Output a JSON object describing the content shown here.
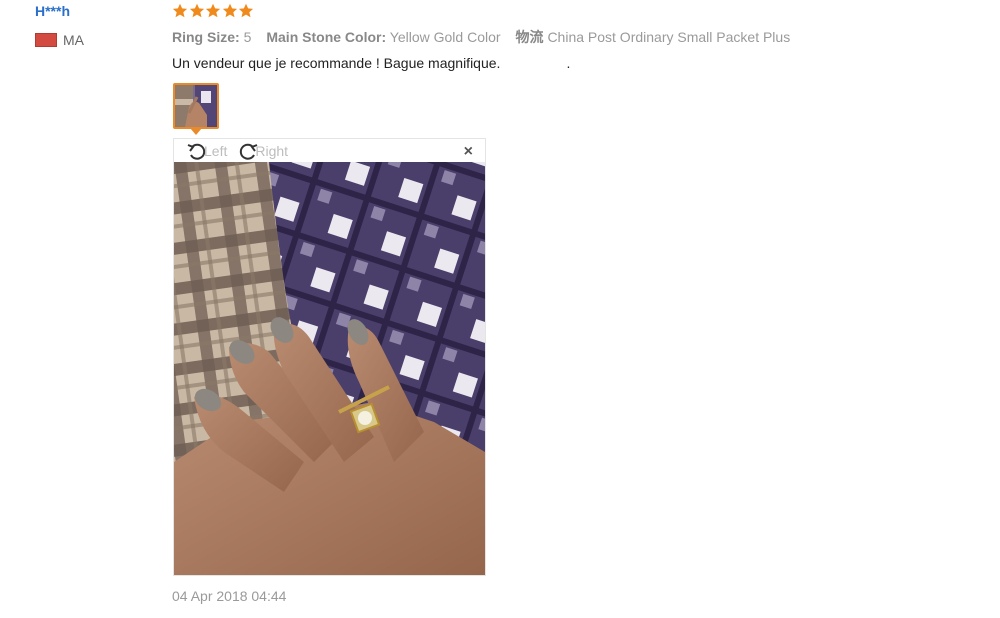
{
  "buyer": {
    "name": "H***h",
    "country_code": "MA"
  },
  "rating": {
    "stars": 5,
    "max": 5,
    "color": "#f08a1c"
  },
  "attributes": [
    {
      "key": "Ring Size:",
      "value": "5"
    },
    {
      "key": "Main Stone Color:",
      "value": "Yellow Gold Color"
    },
    {
      "key": "物流",
      "value": "China Post Ordinary Small Packet Plus"
    }
  ],
  "review_text": "Un vendeur que je recommande ! Bague magnifique.                 .",
  "viewer": {
    "rotate_left_label": "Left",
    "rotate_right_label": "Right",
    "close_symbol": "×"
  },
  "date": "04 Apr 2018 04:44",
  "colors": {
    "buyer_link": "#2a6fc9",
    "thumb_border": "#e98a2b",
    "flag": "#d24a40"
  }
}
